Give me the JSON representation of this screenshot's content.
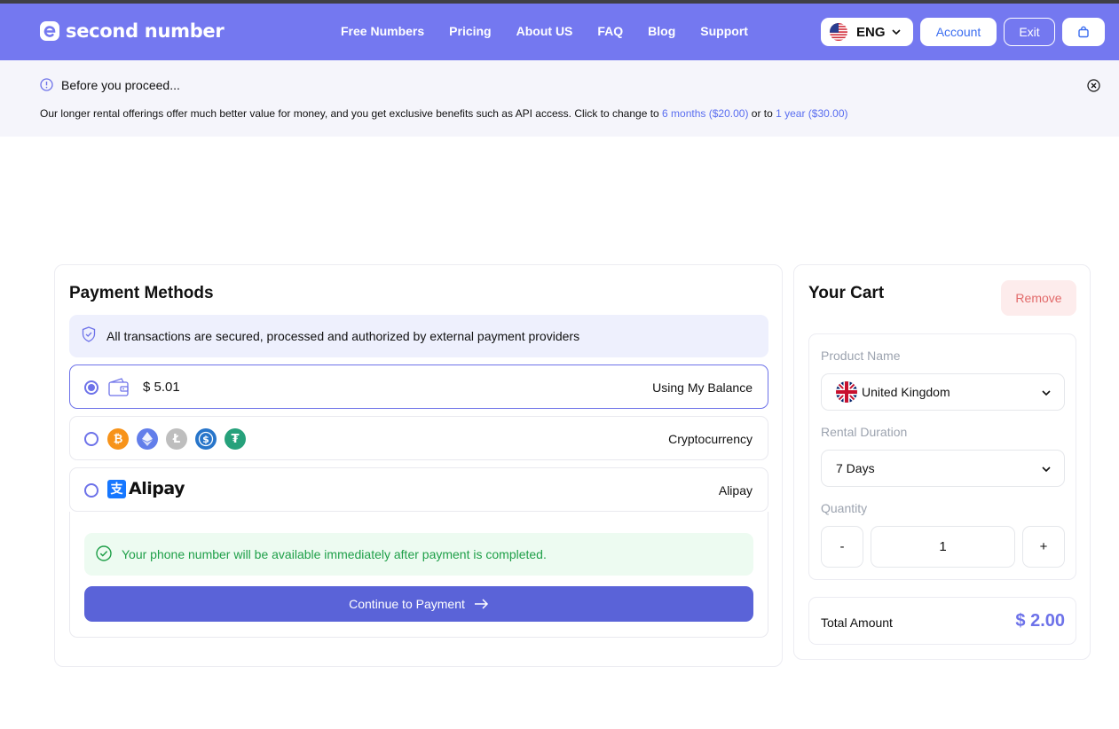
{
  "header": {
    "logo_text": "second number",
    "nav": [
      "Free Numbers",
      "Pricing",
      "About US",
      "FAQ",
      "Blog",
      "Support"
    ],
    "language": "ENG",
    "account_label": "Account",
    "exit_label": "Exit"
  },
  "notice": {
    "title": "Before you proceed...",
    "text_before": "Our longer rental offerings offer much better value for money, and you get exclusive benefits such as API access. Click to change to ",
    "link1": "6 months ($20.00)",
    "text_middle": " or to ",
    "link2": "1 year ($30.00)"
  },
  "payment": {
    "title": "Payment Methods",
    "secure_text": "All transactions are secured, processed and authorized by external payment providers",
    "options": [
      {
        "label": "Using My Balance",
        "value": "$ 5.01",
        "selected": true
      },
      {
        "label": "Cryptocurrency",
        "coins": [
          "bitcoin-icon",
          "ethereum-icon",
          "litecoin-icon",
          "usdc-icon",
          "tether-icon"
        ],
        "selected": false
      },
      {
        "label": "Alipay",
        "logo_text": "Alipay",
        "selected": false
      }
    ],
    "success_text": "Your phone number will be available immediately after payment is completed.",
    "continue_label": "Continue to Payment"
  },
  "cart": {
    "title": "Your Cart",
    "remove_label": "Remove",
    "product_label": "Product Name",
    "product_value": "United Kingdom",
    "duration_label": "Rental Duration",
    "duration_value": "7 Days",
    "quantity_label": "Quantity",
    "quantity_value": "1",
    "minus_label": "-",
    "plus_label": "+",
    "total_label": "Total Amount",
    "total_value": "$ 2.00"
  },
  "colors": {
    "brand": "#7478f0",
    "accent": "#6d72e9",
    "button": "#5a63d8",
    "success": "#1e9f48"
  }
}
